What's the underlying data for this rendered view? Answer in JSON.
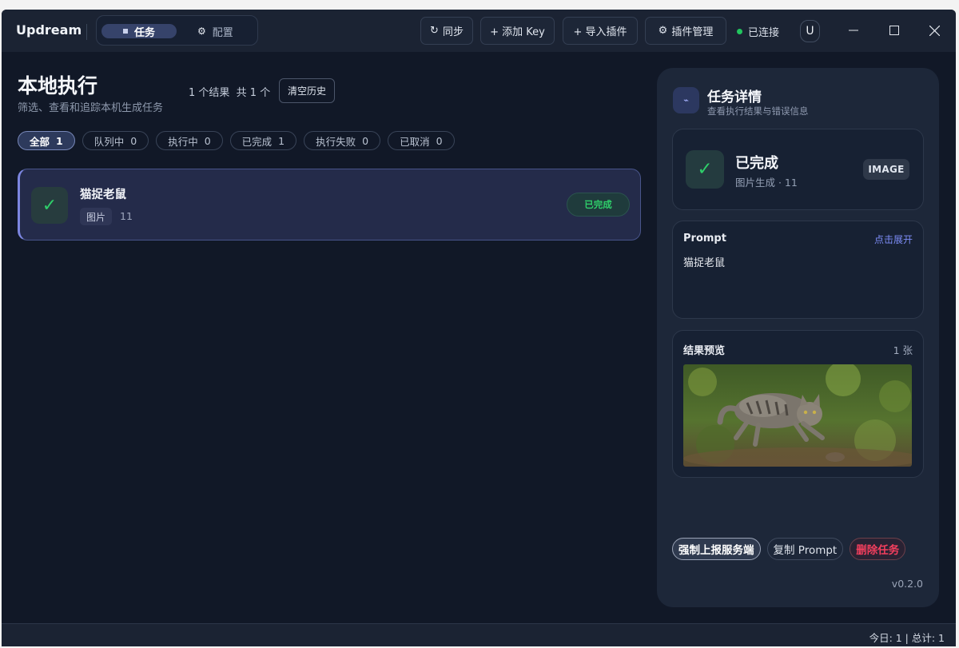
{
  "titlebar": {
    "brand": "Updream",
    "nav": {
      "tasks": "任务",
      "config": "配置"
    },
    "buttons": {
      "sync": "同步",
      "add_key": "+ 添加 Key",
      "import_plugin": "+ 导入插件",
      "plugin_manage": "插件管理"
    },
    "connection": {
      "label": "已连接",
      "color": "#22c55e"
    },
    "user_initial": "U"
  },
  "main": {
    "title": "本地执行",
    "subtitle": "筛选、查看和追踪本机生成任务",
    "result_count": "1 个结果",
    "total_count": "共 1 个",
    "clear_history": "清空历史",
    "filters": [
      {
        "label": "全部",
        "count": "1"
      },
      {
        "label": "队列中",
        "count": "0"
      },
      {
        "label": "执行中",
        "count": "0"
      },
      {
        "label": "已完成",
        "count": "1"
      },
      {
        "label": "执行失败",
        "count": "0"
      },
      {
        "label": "已取消",
        "count": "0"
      }
    ],
    "task": {
      "title": "猫捉老鼠",
      "tag": "图片",
      "number": "11",
      "status": "已完成"
    }
  },
  "detail": {
    "title": "任务详情",
    "subtitle": "查看执行结果与错误信息",
    "status": {
      "text": "已完成",
      "sub": "图片生成 · 11",
      "type": "IMAGE"
    },
    "prompt": {
      "label": "Prompt",
      "expand": "点击展开",
      "text": "猫捉老鼠"
    },
    "preview": {
      "label": "结果预览",
      "count": "1 张"
    },
    "actions": {
      "report": "强制上报服务端",
      "copy": "复制 Prompt",
      "delete": "删除任务"
    },
    "version": "v0.2.0"
  },
  "footer": {
    "stats": "今日: 1 | 总计: 1"
  },
  "colors": {
    "accent": "#7c86e0",
    "success": "#2fcf6a",
    "danger": "#f43f5e",
    "link": "#7c8cf5"
  }
}
